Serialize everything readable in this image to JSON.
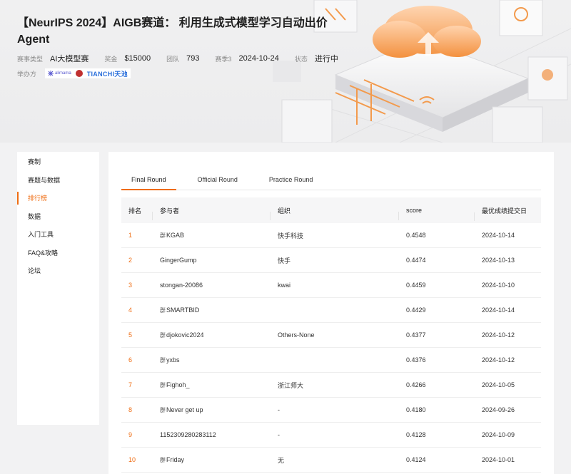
{
  "competition": {
    "title": "【NeurIPS 2024】AIGB赛道： 利用生成式模型学习自动出价Agent",
    "meta": [
      {
        "label": "赛事类型",
        "value": "AI大模型赛"
      },
      {
        "label": "奖金",
        "value": "$15000"
      },
      {
        "label": "团队",
        "value": "793"
      },
      {
        "label": "赛季3",
        "value": "2024-10-24"
      },
      {
        "label": "状态",
        "value": "进行中"
      }
    ],
    "organizer_label": "举办方",
    "organizer_logo_a": "alimama",
    "organizer_logo_c": "TIANCHI天池"
  },
  "sidebar": {
    "items": [
      {
        "label": "赛制",
        "active": false
      },
      {
        "label": "赛题与数据",
        "active": false
      },
      {
        "label": "排行榜",
        "active": true
      },
      {
        "label": "数据",
        "active": false
      },
      {
        "label": "入门工具",
        "active": false
      },
      {
        "label": "FAQ&攻略",
        "active": false
      },
      {
        "label": "论坛",
        "active": false
      }
    ]
  },
  "tabs": [
    {
      "label": "Final Round",
      "active": true
    },
    {
      "label": "Official Round",
      "active": false
    },
    {
      "label": "Practice Round",
      "active": false
    }
  ],
  "table": {
    "headers": {
      "rank": "排名",
      "user": "参与者",
      "org": "组织",
      "score": "score",
      "date": "最优成绩提交日"
    },
    "team_icon": "team-icon",
    "rows": [
      {
        "rank": "1",
        "team": true,
        "user": "KGAB",
        "org": "快手科技",
        "score": "0.4548",
        "date": "2024-10-14"
      },
      {
        "rank": "2",
        "team": false,
        "user": "GingerGump",
        "org": "快手",
        "score": "0.4474",
        "date": "2024-10-13"
      },
      {
        "rank": "3",
        "team": false,
        "user": "stongan-20086",
        "org": "kwai",
        "score": "0.4459",
        "date": "2024-10-10"
      },
      {
        "rank": "4",
        "team": true,
        "user": "SMARTBID",
        "org": "",
        "score": "0.4429",
        "date": "2024-10-14"
      },
      {
        "rank": "5",
        "team": true,
        "user": "djokovic2024",
        "org": "Others-None",
        "score": "0.4377",
        "date": "2024-10-12"
      },
      {
        "rank": "6",
        "team": true,
        "user": "yxbs",
        "org": "",
        "score": "0.4376",
        "date": "2024-10-12"
      },
      {
        "rank": "7",
        "team": true,
        "user": "Fighoh_",
        "org": "浙江师大",
        "score": "0.4266",
        "date": "2024-10-05"
      },
      {
        "rank": "8",
        "team": true,
        "user": "Never get up",
        "org": "-",
        "score": "0.4180",
        "date": "2024-09-26"
      },
      {
        "rank": "9",
        "team": false,
        "user": "1152309280283112",
        "org": "-",
        "score": "0.4128",
        "date": "2024-10-09"
      },
      {
        "rank": "10",
        "team": true,
        "user": "Friday",
        "org": "无",
        "score": "0.4124",
        "date": "2024-10-01"
      }
    ]
  },
  "colors": {
    "accent": "#ef6c12"
  }
}
